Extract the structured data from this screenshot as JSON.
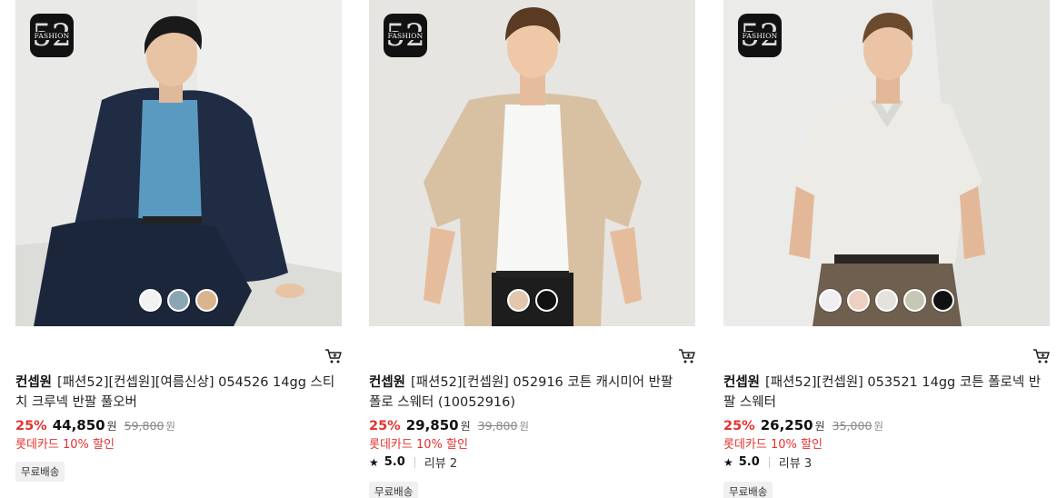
{
  "products": [
    {
      "brand": "컨셉원",
      "name": "[패션52][컨셉원][여름신상] 054526 14gg 스티치 크루넥 반팔 풀오버",
      "discount": "25%",
      "price": "44,850",
      "price_unit": "원",
      "original_price": "59,800",
      "promo": "롯데카드 10% 할인",
      "shipping": "무료배송",
      "swatches": [
        "#f2f2f2",
        "#8aa5b4",
        "#d9b48d"
      ],
      "logo_word": "FASHION",
      "logo_num": "52"
    },
    {
      "brand": "컨셉원",
      "name": "[패션52][컨셉원] 052916 코튼 캐시미어 반팔 폴로 스웨터 (10052916)",
      "discount": "25%",
      "price": "29,850",
      "price_unit": "원",
      "original_price": "39,800",
      "promo": "롯데카드 10% 할인",
      "rating": "5.0",
      "reviews": "리뷰 2",
      "shipping": "무료배송",
      "swatches": [
        "#e2c7ad",
        "#111111"
      ],
      "logo_word": "FASHION",
      "logo_num": "52"
    },
    {
      "brand": "컨셉원",
      "name": "[패션52][컨셉원] 053521 14gg 코튼 폴로넥 반팔 스웨터",
      "discount": "25%",
      "price": "26,250",
      "price_unit": "원",
      "original_price": "35,000",
      "promo": "롯데카드 10% 할인",
      "rating": "5.0",
      "reviews": "리뷰 3",
      "shipping": "무료배송",
      "swatches": [
        "#eeeef3",
        "#efcfc0",
        "#e4e2dc",
        "#c7c7b6",
        "#111111"
      ],
      "logo_word": "FASHION",
      "logo_num": "52"
    }
  ]
}
